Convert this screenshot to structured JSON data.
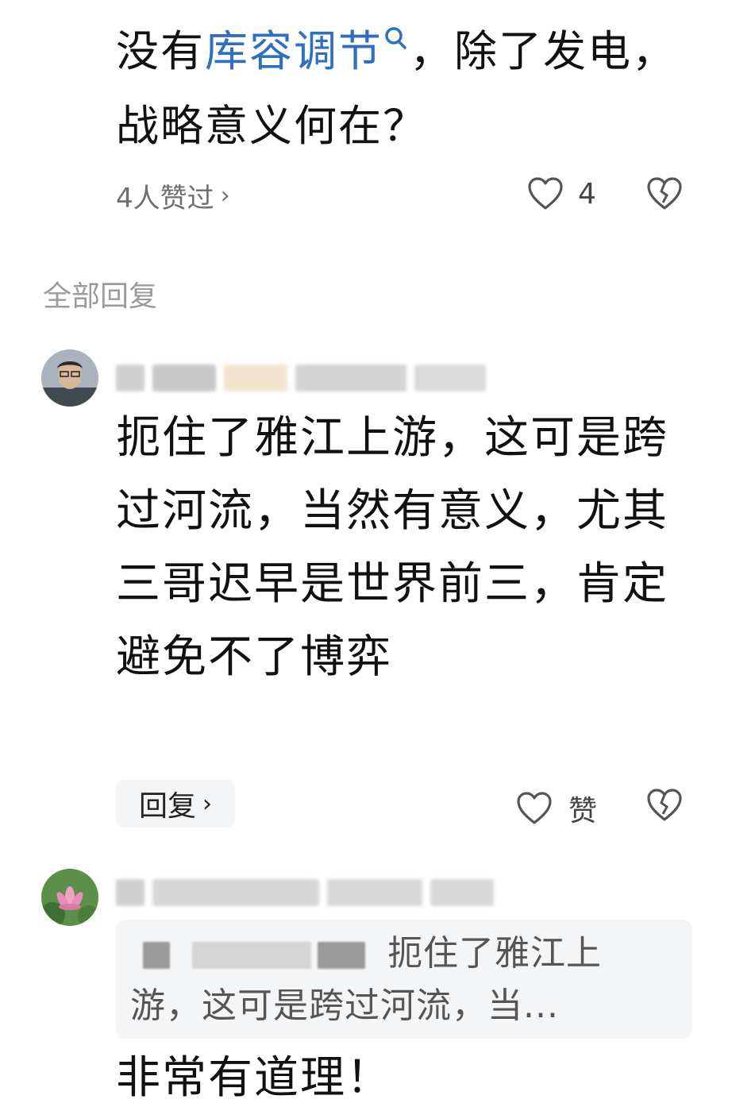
{
  "main_comment": {
    "text_before": "没有",
    "keyword": "库容调节",
    "text_after": "，除了发电，战略意义何在？",
    "liked_by": "4人赞过",
    "like_count": "4"
  },
  "section_title": "全部回复",
  "replies": [
    {
      "text": "扼住了雅江上游，这可是跨过河流，当然有意义，尤其三哥迟早是世界前三，肯定避免不了博弈",
      "reply_label": "回复",
      "praise_label": "赞"
    }
  ],
  "second_reply": {
    "quoted_text": "扼住了雅江上游，这可是跨过河流，当...",
    "text": "非常有道理！"
  },
  "icons": {
    "heart": "heart-outline-icon",
    "dislike": "broken-heart-icon",
    "search": "search-icon",
    "chevron": "chevron-right-icon"
  },
  "colors": {
    "link": "#2f6fbf",
    "meta_gray": "#6f6f6f",
    "section_gray": "#9b9b9b",
    "button_bg": "#f4f5f7"
  }
}
